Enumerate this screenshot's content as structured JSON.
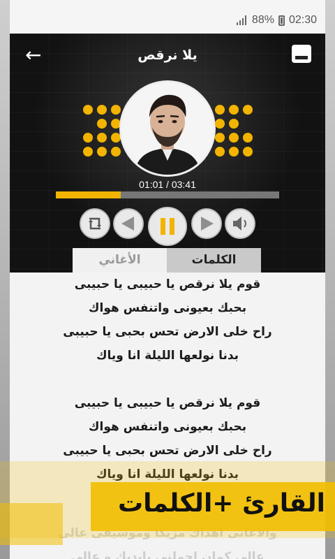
{
  "status_bar": {
    "battery_percent": "88%",
    "time": "02:30"
  },
  "header": {
    "title": "يلا نرقص"
  },
  "player": {
    "current_time": "01:01",
    "total_time": "03:41",
    "time_display": "01:01 / 03:41",
    "progress": 0.29
  },
  "controls": {
    "repeat": "repeat-icon",
    "prev": "previous-icon",
    "play": "pause-icon",
    "next": "next-icon",
    "volume": "volume-icon"
  },
  "tabs": [
    {
      "label": "الكلمات",
      "active": true
    },
    {
      "label": "الأغاني",
      "active": false
    }
  ],
  "lyrics": {
    "verse1": [
      "قوم يلا نرقص يا حبيبى يا حبيبى",
      "بحبك بعيونى واتنفس هواك",
      "راح خلى الارض تحس بحبى يا حبيبى",
      "بدنا نولعها الليلة انا وياك"
    ],
    "verse2": [
      "قوم يلا نرقص يا حبيبى يا حبيبى",
      "بحبك بعيونى واتنفس هواك",
      "راح خلى الارض تحس بحبى يا حبيبى",
      "بدنا نولعها الليلة انا وياك"
    ],
    "faded": [
      "والاغانى اهداك مزيكا وموسيقى عالى",
      "عالى كمان احملني بإيديك و عالى"
    ]
  },
  "banner": {
    "text": "القارئ +الكلمات"
  },
  "colors": {
    "accent": "#f2b400",
    "player_bg": "#121212",
    "tab_active": "#c9c9c9"
  }
}
